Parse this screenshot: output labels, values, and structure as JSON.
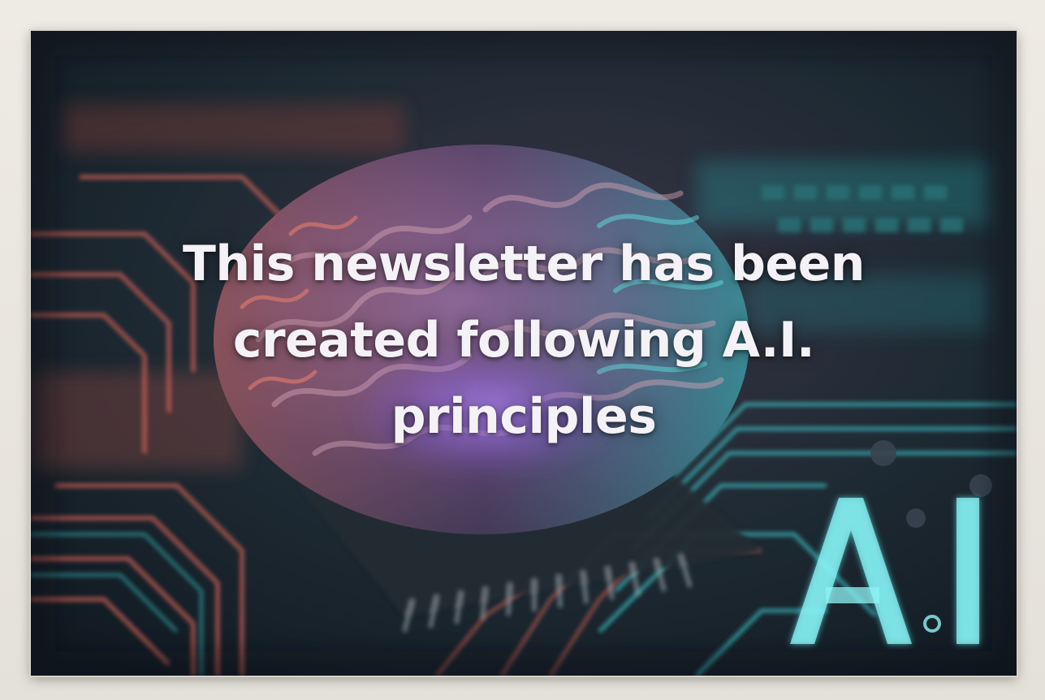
{
  "caption": {
    "line1": "This newsletter has been",
    "line2": "created following A.I.",
    "line3": "principles"
  },
  "ai_mark": {
    "letter_a": "A",
    "letter_i": "I"
  },
  "colors": {
    "frame": "#e9e6df",
    "circuit_teal": "#3fd3d8",
    "circuit_coral": "#e0685a",
    "brain_purple": "#8a5fc8",
    "caption_text": "#f4f2f6"
  }
}
